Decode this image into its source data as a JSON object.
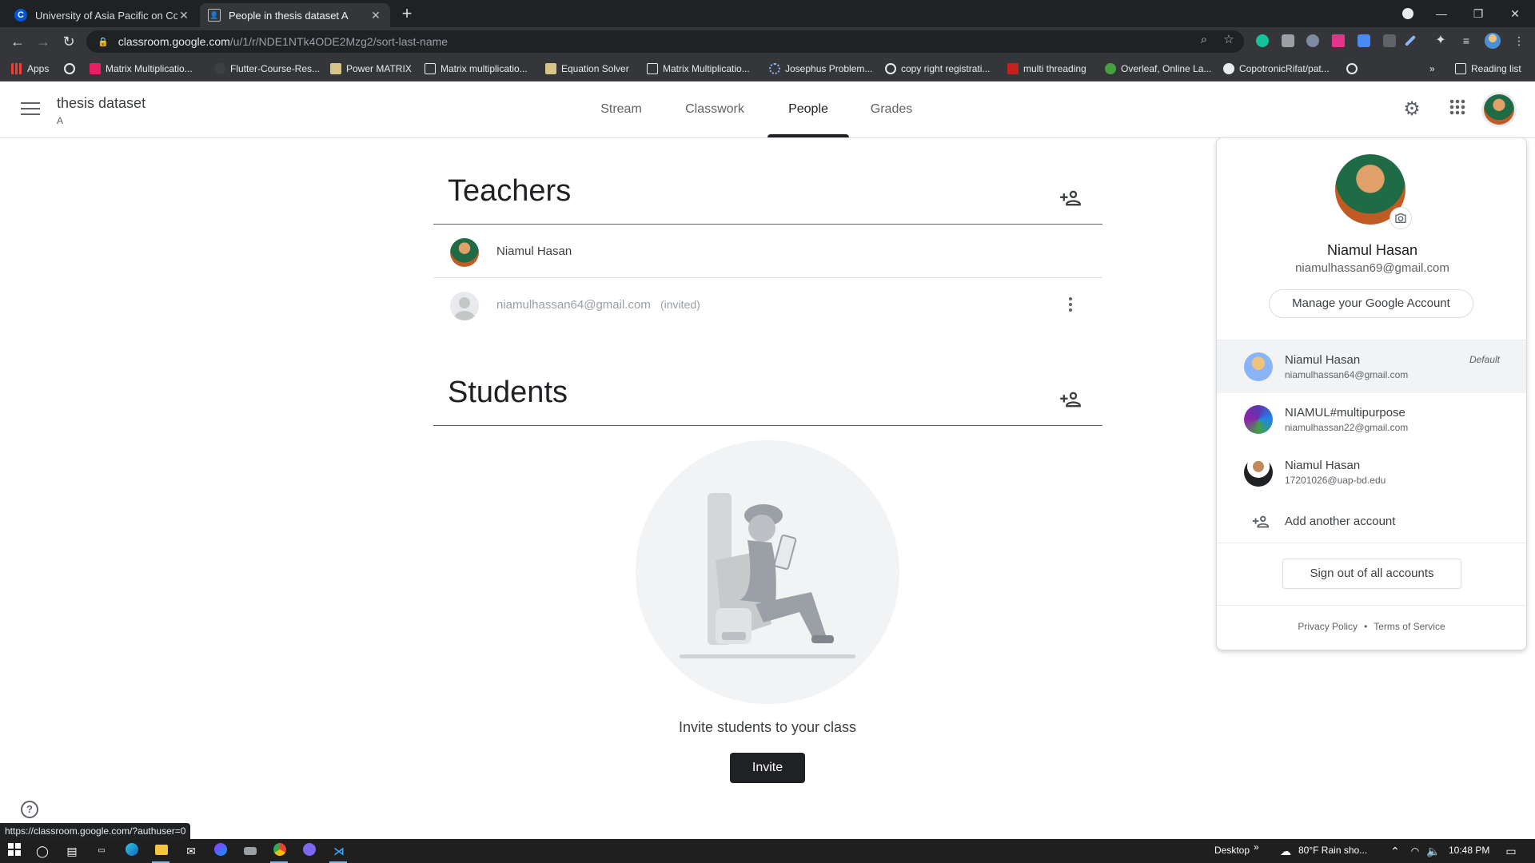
{
  "browser": {
    "tabs": [
      {
        "title": "University of Asia Pacific on Cour",
        "favicon": "coursera-icon",
        "active": false
      },
      {
        "title": "People in thesis dataset A",
        "favicon": "classroom-icon",
        "active": true
      }
    ],
    "url_host": "classroom.google.com",
    "url_path": "/u/1/r/NDE1NTk4ODE2Mzg2/sort-last-name",
    "bookmarks": [
      "Apps",
      "Matrix Multiplicatio...",
      "Flutter-Course-Res...",
      "Power MATRIX",
      "Matrix multiplicatio...",
      "Equation Solver",
      "Matrix Multiplicatio...",
      "Josephus Problem...",
      "copy right registrati...",
      "multi threading",
      "Overleaf, Online La...",
      "CopotronicRifat/pat..."
    ],
    "reading_list": "Reading list",
    "status_url": "https://classroom.google.com/?authuser=0"
  },
  "classroom": {
    "class_name": "thesis dataset",
    "section": "A",
    "tabs": [
      "Stream",
      "Classwork",
      "People",
      "Grades"
    ],
    "active_tab": "People",
    "teachers_title": "Teachers",
    "teachers": [
      {
        "name": "Niamul Hasan"
      },
      {
        "email": "niamulhassan64@gmail.com",
        "status": "(invited)"
      }
    ],
    "students_title": "Students",
    "empty_message": "Invite students to your class",
    "invite_label": "Invite"
  },
  "account_menu": {
    "name": "Niamul Hasan",
    "email": "niamulhassan69@gmail.com",
    "manage_label": "Manage your Google Account",
    "accounts": [
      {
        "name": "Niamul Hasan",
        "email": "niamulhassan64@gmail.com",
        "badge": "Default"
      },
      {
        "name": "NIAMUL#multipurpose",
        "email": "niamulhassan22@gmail.com",
        "badge": ""
      },
      {
        "name": "Niamul Hasan",
        "email": "17201026@uap-bd.edu",
        "badge": ""
      }
    ],
    "add_account_label": "Add another account",
    "signout_label": "Sign out of all accounts",
    "privacy_label": "Privacy Policy",
    "terms_label": "Terms of Service"
  },
  "taskbar": {
    "desktop_label": "Desktop",
    "weather": "80°F  Rain sho...",
    "time": "10:48 PM"
  }
}
